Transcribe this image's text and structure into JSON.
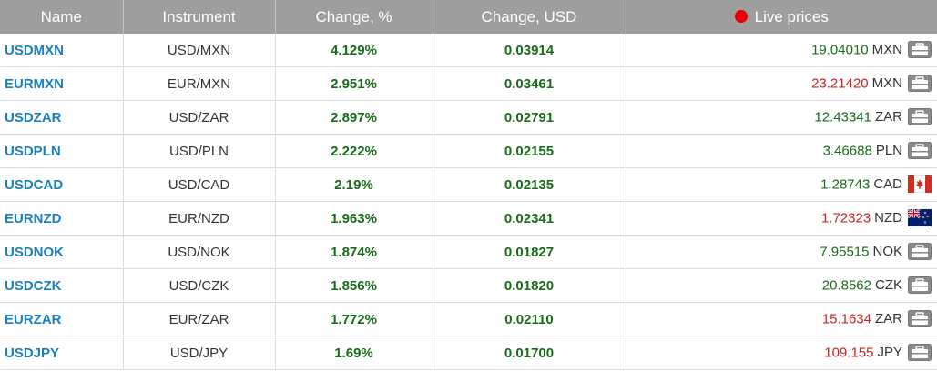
{
  "header": {
    "name": "Name",
    "instrument": "Instrument",
    "change_pct": "Change, %",
    "change_usd": "Change, USD",
    "live_prices": "Live prices"
  },
  "colors": {
    "header_bg": "#9e9e9e",
    "name_link": "#1a7fbf",
    "up": "#1a6b1a",
    "down": "#cc1f1f",
    "live_dot": "#e50000"
  },
  "rows": [
    {
      "name": "USDMXN",
      "instrument": "USD/MXN",
      "change_pct": "4.129%",
      "change_usd": "0.03914",
      "price": "19.04010",
      "currency": "MXN",
      "direction": "up",
      "icon": "briefcase-icon"
    },
    {
      "name": "EURMXN",
      "instrument": "EUR/MXN",
      "change_pct": "2.951%",
      "change_usd": "0.03461",
      "price": "23.21420",
      "currency": "MXN",
      "direction": "down",
      "icon": "briefcase-icon"
    },
    {
      "name": "USDZAR",
      "instrument": "USD/ZAR",
      "change_pct": "2.897%",
      "change_usd": "0.02791",
      "price": "12.43341",
      "currency": "ZAR",
      "direction": "up",
      "icon": "briefcase-icon"
    },
    {
      "name": "USDPLN",
      "instrument": "USD/PLN",
      "change_pct": "2.222%",
      "change_usd": "0.02155",
      "price": "3.46688",
      "currency": "PLN",
      "direction": "up",
      "icon": "briefcase-icon"
    },
    {
      "name": "USDCAD",
      "instrument": "USD/CAD",
      "change_pct": "2.19%",
      "change_usd": "0.02135",
      "price": "1.28743",
      "currency": "CAD",
      "direction": "up",
      "icon": "canada-flag-icon"
    },
    {
      "name": "EURNZD",
      "instrument": "EUR/NZD",
      "change_pct": "1.963%",
      "change_usd": "0.02341",
      "price": "1.72323",
      "currency": "NZD",
      "direction": "down",
      "icon": "new-zealand-flag-icon"
    },
    {
      "name": "USDNOK",
      "instrument": "USD/NOK",
      "change_pct": "1.874%",
      "change_usd": "0.01827",
      "price": "7.95515",
      "currency": "NOK",
      "direction": "up",
      "icon": "briefcase-icon"
    },
    {
      "name": "USDCZK",
      "instrument": "USD/CZK",
      "change_pct": "1.856%",
      "change_usd": "0.01820",
      "price": "20.8562",
      "currency": "CZK",
      "direction": "up",
      "icon": "briefcase-icon"
    },
    {
      "name": "EURZAR",
      "instrument": "EUR/ZAR",
      "change_pct": "1.772%",
      "change_usd": "0.02110",
      "price": "15.1634",
      "currency": "ZAR",
      "direction": "down",
      "icon": "briefcase-icon"
    },
    {
      "name": "USDJPY",
      "instrument": "USD/JPY",
      "change_pct": "1.69%",
      "change_usd": "0.01700",
      "price": "109.155",
      "currency": "JPY",
      "direction": "down",
      "icon": "briefcase-icon"
    }
  ]
}
